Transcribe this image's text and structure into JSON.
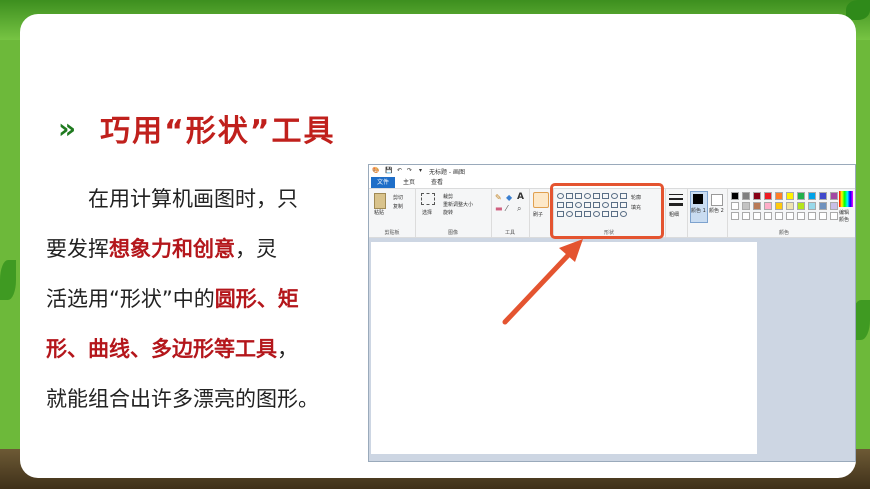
{
  "slide": {
    "title": "巧用“形状”工具",
    "chevron": "»",
    "body_lines": [
      {
        "parts": [
          {
            "t": "　　在用计算机画图时，只",
            "hl": false
          }
        ]
      },
      {
        "parts": [
          {
            "t": "要发挥",
            "hl": false
          },
          {
            "t": "想象力和创意",
            "hl": true
          },
          {
            "t": "，灵",
            "hl": false
          }
        ]
      },
      {
        "parts": [
          {
            "t": "活选用“形状”中的",
            "hl": false
          },
          {
            "t": "圆形、矩",
            "hl": true
          }
        ]
      },
      {
        "parts": [
          {
            "t": "形、曲线、多边形等工具",
            "hl": true
          },
          {
            "t": "，",
            "hl": false
          }
        ]
      },
      {
        "parts": [
          {
            "t": "就能组合出许多漂亮的图形。",
            "hl": false
          }
        ]
      }
    ],
    "colors": {
      "title": "#c0201c",
      "highlight": "#b4161b",
      "chevron": "#1f7a1f",
      "callout": "#e45430"
    }
  },
  "paint": {
    "window_title": "无标题 - 画图",
    "tabs": [
      "文件",
      "主页",
      "查看"
    ],
    "clipboard": {
      "paste": "粘贴",
      "cut": "剪切",
      "copy": "复制",
      "label": "剪贴板"
    },
    "image": {
      "select": "选择",
      "crop": "裁剪",
      "resize": "重新调整大小",
      "rotate": "旋转",
      "label": "图像"
    },
    "tools": {
      "label": "工具"
    },
    "brushes": {
      "label": "刷子"
    },
    "shapes": {
      "outline": "轮廓",
      "fill": "填充",
      "label": "形状"
    },
    "size": {
      "label": "粗细"
    },
    "color1": {
      "label": "颜色 1"
    },
    "color2": {
      "label": "颜色 2"
    },
    "edit_colors": {
      "label": "编辑颜色"
    },
    "colors_group": {
      "label": "颜色"
    },
    "palette": [
      "#000000",
      "#7f7f7f",
      "#880015",
      "#ed1c24",
      "#ff7f27",
      "#fff200",
      "#22b14c",
      "#00a2e8",
      "#3f48cc",
      "#a349a4",
      "#ffffff",
      "#c3c3c3",
      "#b97a57",
      "#ffaec9",
      "#ffc90e",
      "#efe4b0",
      "#b5e61d",
      "#99d9ea",
      "#7092be",
      "#c8bfe7"
    ]
  }
}
